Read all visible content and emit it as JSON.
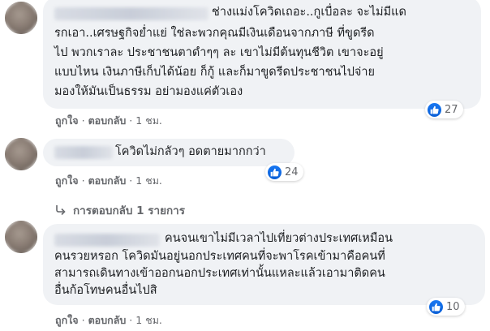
{
  "comments": [
    {
      "lines": [
        "ช่างแม่งโควิดเถอะ..กูเบื่อละ จะไม่มีแด",
        "รกเอา..เศรษฐกิจย่ำแย่ ใช่ละพวกคุณมีเงินเดือนจากภาษี ที่ขูดรีด",
        "ไป พวกเราละ ประชาชนตาดำๆๆ ละ เขาไม่มีต้นทุนชีวิต เขาจะอยู่",
        "แบบไหน เงินภาษีเก็บได้น้อย ก็กู้ และก็มาขูดรีดประชาชนไปจ่าย",
        "มองให้มันเป็นธรรม อย่ามองแค่ตัวเอง"
      ],
      "like": "ถูกใจ",
      "reply": "ตอบกลับ",
      "time": "1 ชม.",
      "reaction_count": "27"
    },
    {
      "lines": [
        "โควิดไม่กลัวๆ อดตายมากกว่า"
      ],
      "like": "ถูกใจ",
      "reply": "ตอบกลับ",
      "time": "1 ชม.",
      "reaction_count": "24",
      "replies_text": "การตอบกลับ 1 รายการ"
    },
    {
      "lines": [
        "คนจนเขาไม่มีเวลาไปเที่ยวต่างประเทศเหมือน",
        "คนรวยหรอก โควิดมันอยู่นอกประเทศคนที่จะพาโรคเข้ามาคือคนที่",
        "สามารถเดินทางเข้าออกนอกประเทศเท่านั้นแหละแล้วเอามาติดคน",
        "อื่นก้อโทษคนอื่นไปสิ"
      ],
      "like": "ถูกใจ",
      "reply": "ตอบกลับ",
      "time": "1 ชม.",
      "reaction_count": "10"
    }
  ],
  "colors": {
    "bubble": "#f0f2f5",
    "like_blue": "#1877f2",
    "meta_gray": "#65676b"
  },
  "icons": {
    "reaction": "like-thumb-icon",
    "replies": "reply-arrow-icon"
  }
}
